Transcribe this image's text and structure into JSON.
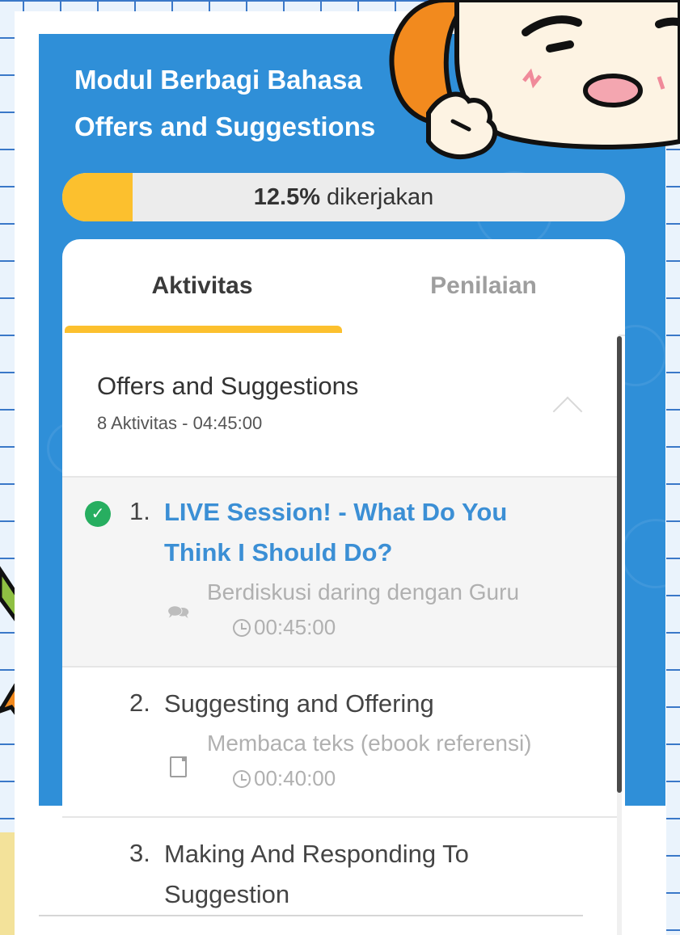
{
  "header": {
    "title_line1": "Modul Berbagi Bahasa",
    "title_line2": "Offers and Suggestions"
  },
  "progress": {
    "percent_label": "12.5%",
    "suffix": "dikerjakan",
    "fraction": 0.125
  },
  "tabs": [
    {
      "label": "Aktivitas",
      "active": true
    },
    {
      "label": "Penilaian",
      "active": false
    }
  ],
  "section": {
    "title": "Offers and Suggestions",
    "meta": "8 Aktivitas - 04:45:00"
  },
  "activities": [
    {
      "number": "1.",
      "title_lines": [
        "LIVE Session! - What Do You",
        "Think I Should Do?"
      ],
      "type": "Berdiskusi daring dengan Guru",
      "duration": "00:45:00",
      "completed": true
    },
    {
      "number": "2.",
      "title_lines": [
        "Suggesting and Offering"
      ],
      "type": "Membaca teks (ebook referensi)",
      "duration": "00:40:00",
      "completed": false
    },
    {
      "number": "3.",
      "title_lines": [
        "Making And Responding To",
        "Suggestion"
      ],
      "completed": false
    }
  ],
  "colors": {
    "panel_blue": "#2f8fd8",
    "accent_yellow": "#fcc02e",
    "link_blue": "#3b8fd5",
    "success_green": "#27ae60"
  }
}
